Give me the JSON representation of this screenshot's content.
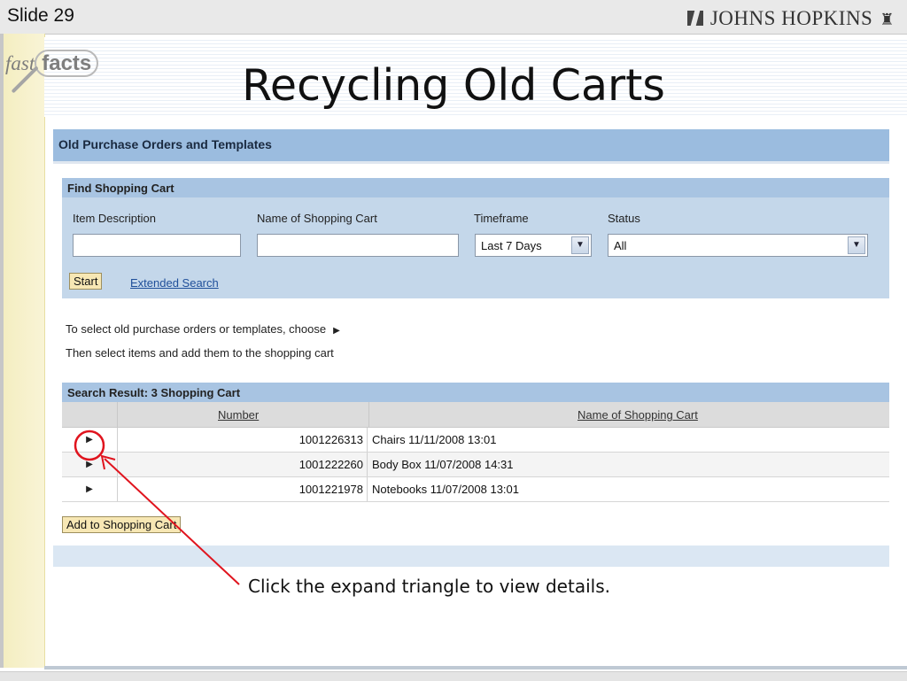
{
  "slide": {
    "number_label": "Slide 29",
    "brand": "JOHNS HOPKINS",
    "logo_script": "fast",
    "logo_word": "facts",
    "title": "Recycling Old Carts"
  },
  "panel": {
    "header": "Old Purchase Orders and Templates",
    "find": {
      "title": "Find Shopping Cart",
      "labels": {
        "item_description": "Item Description",
        "cart_name": "Name of Shopping Cart",
        "timeframe": "Timeframe",
        "status": "Status"
      },
      "values": {
        "item_description": "",
        "cart_name": "",
        "timeframe": "Last 7 Days",
        "status": "All"
      },
      "start_label": "Start",
      "extended_search": "Extended Search"
    },
    "instructions": {
      "line1": "To select old purchase orders or templates, choose",
      "line2": "Then select items and add them to the shopping cart"
    },
    "results": {
      "title": "Search Result:  3 Shopping Cart",
      "columns": {
        "number": "Number",
        "name": "Name of Shopping Cart"
      },
      "rows": [
        {
          "number": "1001226313",
          "name": "Chairs 11/11/2008 13:01"
        },
        {
          "number": "1001222260",
          "name": "Body Box 11/07/2008 14:31"
        },
        {
          "number": "1001221978",
          "name": "Notebooks 11/07/2008 13:01"
        }
      ],
      "add_button": "Add to Shopping Cart"
    }
  },
  "annotation": {
    "caption": "Click the expand triangle to view details.",
    "color": "#e0141e"
  }
}
